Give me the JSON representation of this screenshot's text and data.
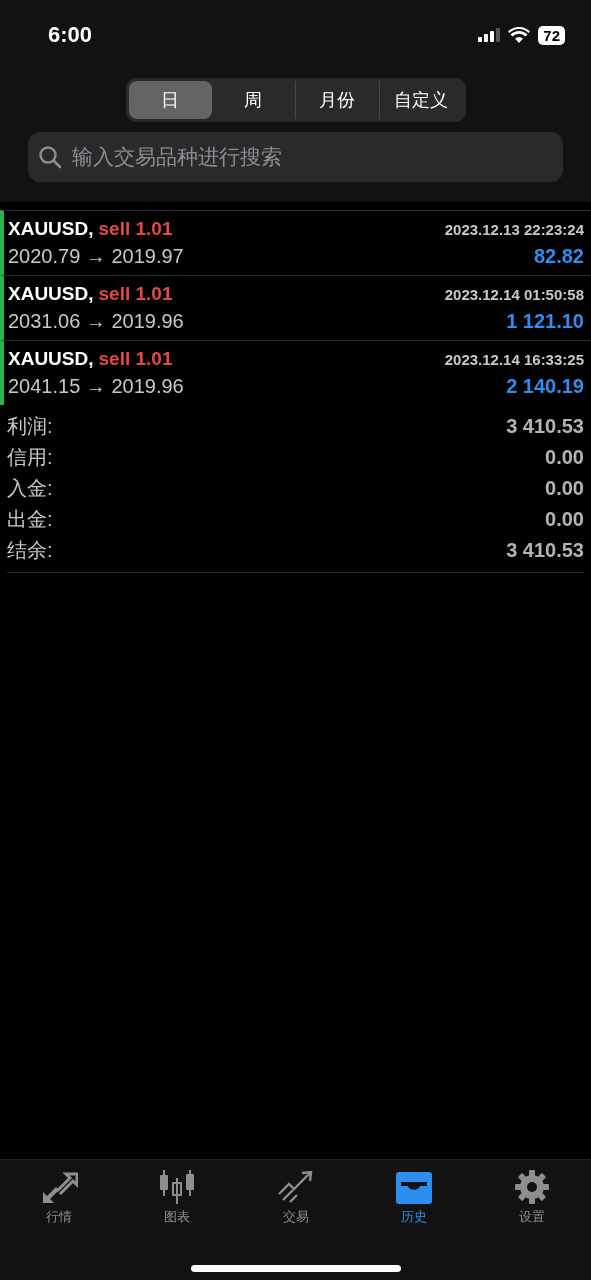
{
  "status_bar": {
    "time": "6:00",
    "battery": "72"
  },
  "period_tabs": [
    {
      "label": "日",
      "selected": true
    },
    {
      "label": "周",
      "selected": false
    },
    {
      "label": "月份",
      "selected": false
    },
    {
      "label": "自定义",
      "selected": false
    }
  ],
  "search": {
    "placeholder": "输入交易品种进行搜索"
  },
  "trades": [
    {
      "symbol": "XAUUSD,",
      "side": "sell 1.01",
      "time": "2023.12.13 22:23:24",
      "prices": "2020.79 → 2019.97",
      "profit": "82.82"
    },
    {
      "symbol": "XAUUSD,",
      "side": "sell 1.01",
      "time": "2023.12.14 01:50:58",
      "prices": "2031.06 → 2019.96",
      "profit": "1 121.10"
    },
    {
      "symbol": "XAUUSD,",
      "side": "sell 1.01",
      "time": "2023.12.14 16:33:25",
      "prices": "2041.15 → 2019.96",
      "profit": "2 140.19"
    }
  ],
  "summary": [
    {
      "label": "利润:",
      "value": "3 410.53"
    },
    {
      "label": "信用:",
      "value": "0.00"
    },
    {
      "label": "入金:",
      "value": "0.00"
    },
    {
      "label": "出金:",
      "value": "0.00"
    },
    {
      "label": "结余:",
      "value": "3 410.53"
    }
  ],
  "bottom_tabs": [
    {
      "label": "行情",
      "kind": "quotes",
      "selected": false
    },
    {
      "label": "图表",
      "kind": "chart",
      "selected": false
    },
    {
      "label": "交易",
      "kind": "trade",
      "selected": false
    },
    {
      "label": "历史",
      "kind": "history",
      "selected": true
    },
    {
      "label": "设置",
      "kind": "settings",
      "selected": false
    }
  ]
}
